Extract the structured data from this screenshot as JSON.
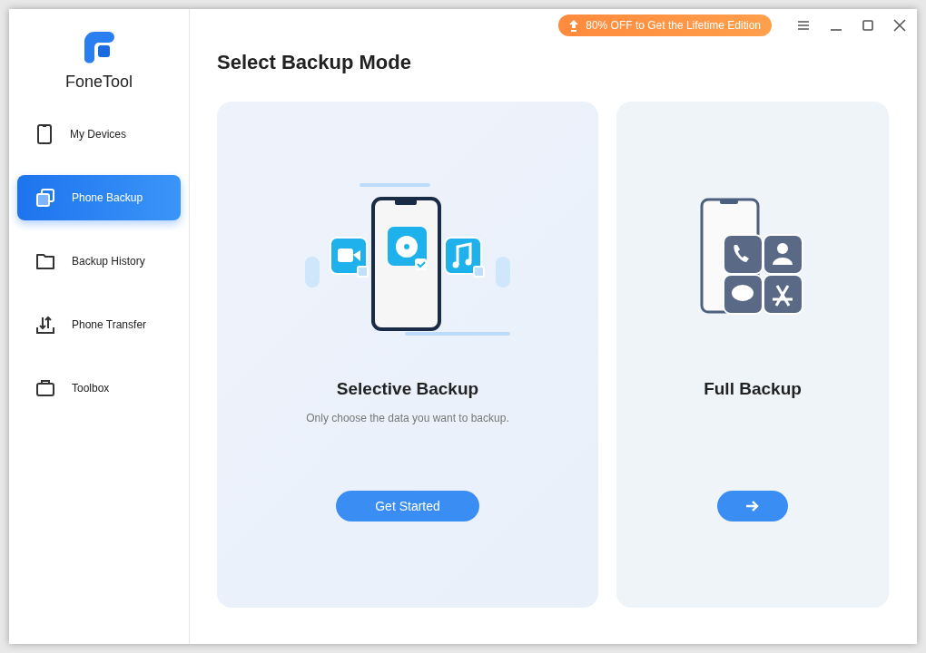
{
  "app": {
    "name": "FoneTool"
  },
  "sidebar": {
    "items": [
      {
        "label": "My Devices",
        "selected": false
      },
      {
        "label": "Phone Backup",
        "selected": true
      },
      {
        "label": "Backup History",
        "selected": false
      },
      {
        "label": "Phone Transfer",
        "selected": false
      },
      {
        "label": "Toolbox",
        "selected": false
      }
    ]
  },
  "promo": {
    "label": "80% OFF to Get the Lifetime Edition"
  },
  "title": "Select Backup Mode",
  "cards": [
    {
      "kind": "selective",
      "title": "Selective Backup",
      "description": "Only choose the data you want to backup.",
      "button": "Get Started"
    },
    {
      "kind": "full",
      "title": "Full Backup"
    }
  ]
}
